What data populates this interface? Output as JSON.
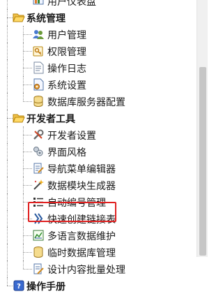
{
  "tree": [
    {
      "type": "item",
      "label": "用户仪表盘",
      "icon": "dashboard-icon"
    },
    {
      "type": "group",
      "label": "系统管理",
      "icon": "open-folder-icon"
    },
    {
      "type": "item",
      "label": "用户管理",
      "icon": "users-icon"
    },
    {
      "type": "item",
      "label": "权限管理",
      "icon": "key-icon"
    },
    {
      "type": "item",
      "label": "操作日志",
      "icon": "document-icon"
    },
    {
      "type": "item",
      "label": "系统设置",
      "icon": "settings-page-icon"
    },
    {
      "type": "item",
      "label": "数据库服务器配置",
      "icon": "database-server-icon"
    },
    {
      "type": "group",
      "label": "开发者工具",
      "icon": "open-folder-icon"
    },
    {
      "type": "item",
      "label": "开发者设置",
      "icon": "tools-icon"
    },
    {
      "type": "item",
      "label": "界面风格",
      "icon": "palette-icon"
    },
    {
      "type": "item",
      "label": "导航菜单编辑器",
      "icon": "edit-menu-icon"
    },
    {
      "type": "item",
      "label": "数据模块生成器",
      "icon": "magic-wand-icon"
    },
    {
      "type": "item",
      "label": "自动编号管理",
      "icon": "numbered-list-icon"
    },
    {
      "type": "item",
      "label": "快速创建链接表",
      "icon": "link-table-icon"
    },
    {
      "type": "item",
      "label": "多语言数据维护",
      "icon": "chart-icon",
      "highlighted": true
    },
    {
      "type": "item",
      "label": "临时数据库管理",
      "icon": "temp-database-icon"
    },
    {
      "type": "item",
      "label": "设计内容批量处理",
      "icon": "batch-design-icon"
    },
    {
      "type": "group",
      "label": "操作手册",
      "icon": "help-book-icon"
    }
  ]
}
